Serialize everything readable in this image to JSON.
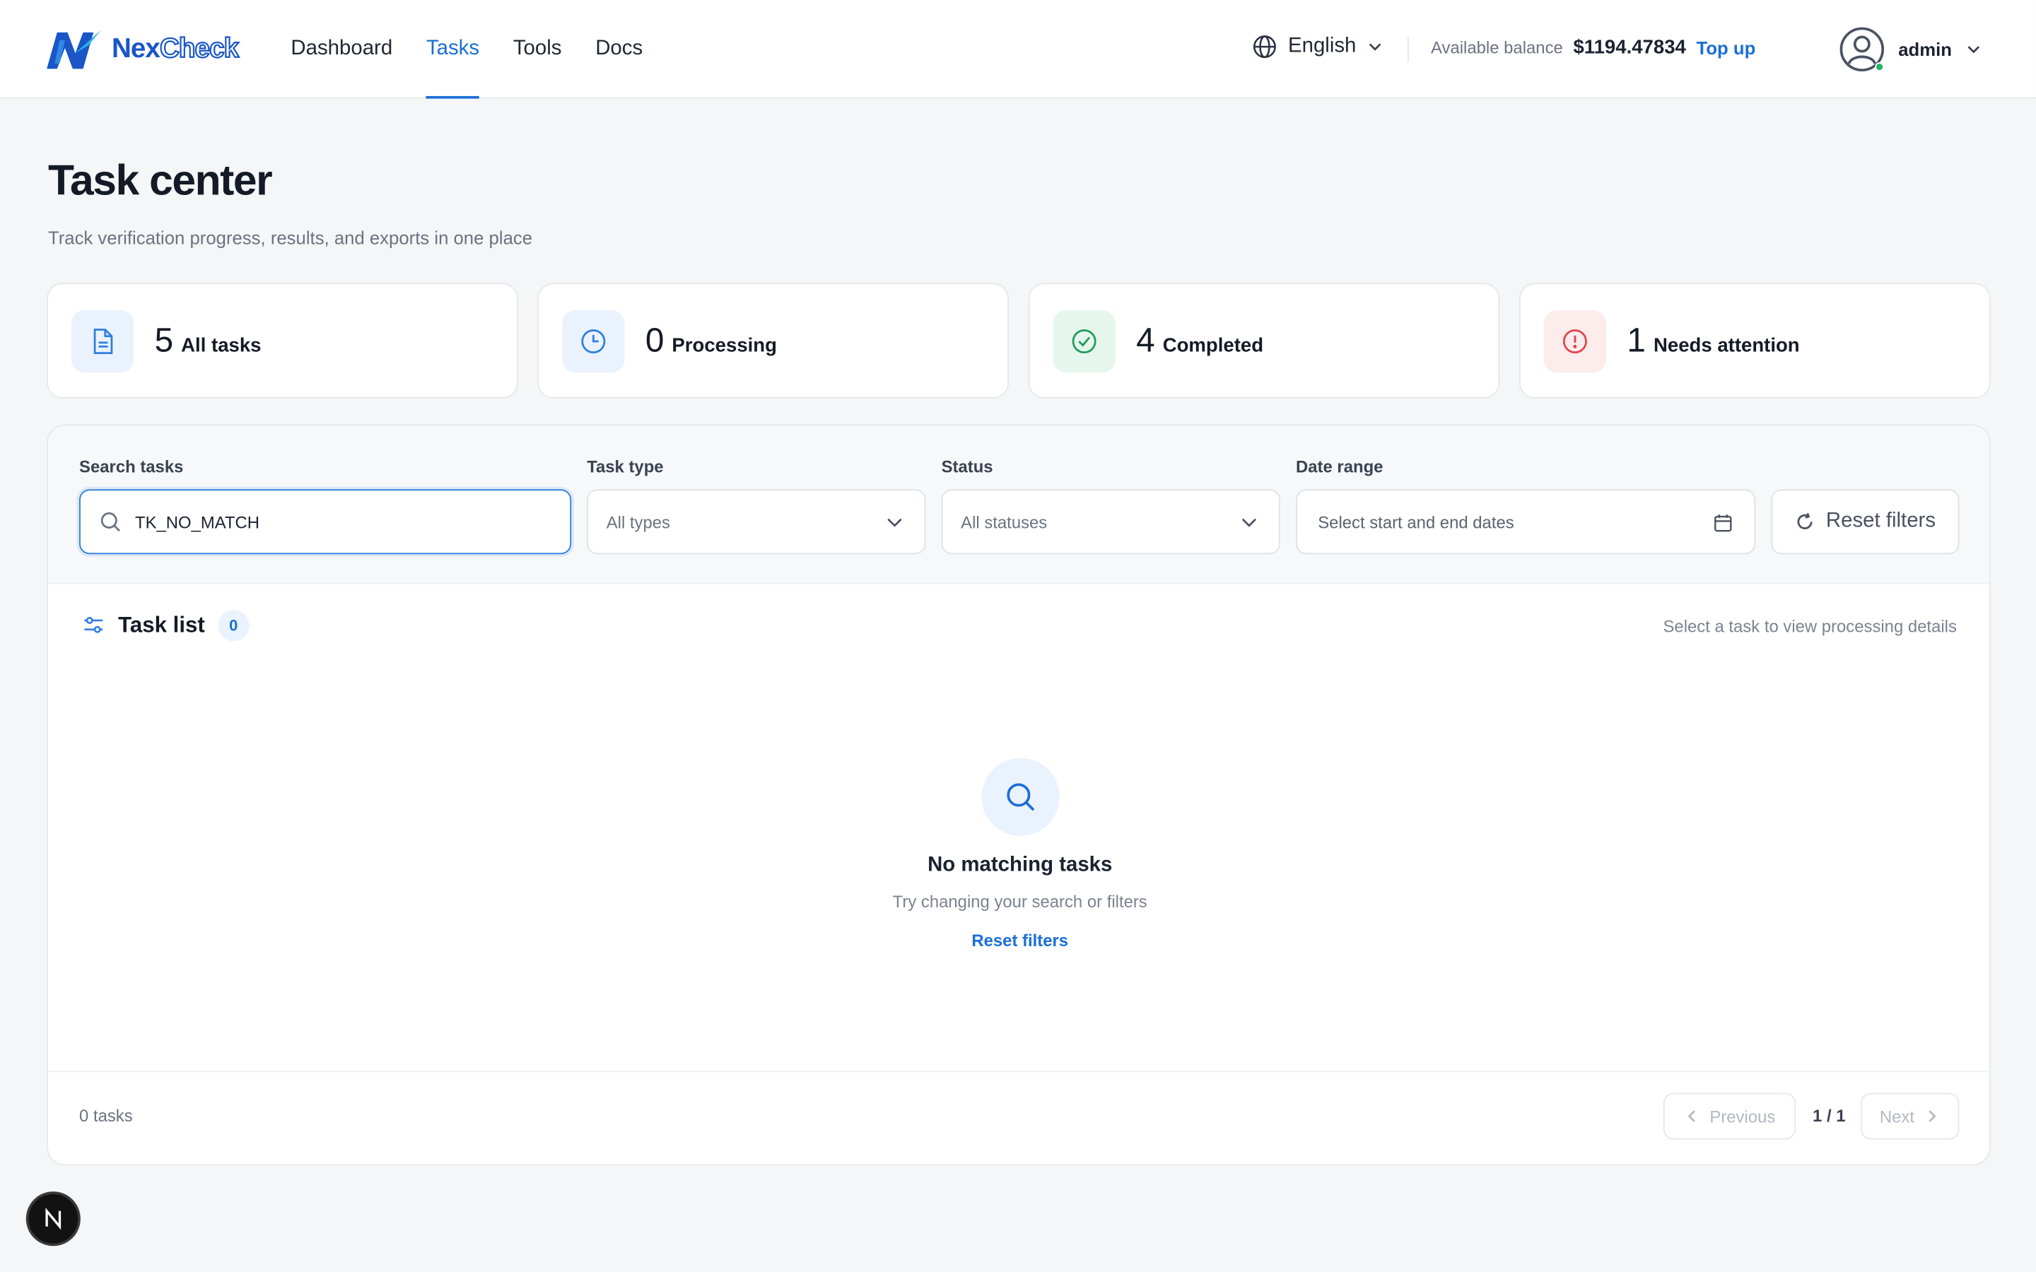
{
  "brand": {
    "name_part1": "Nex",
    "name_part2": "Check",
    "accent": "#1a6fd6"
  },
  "nav": {
    "items": [
      {
        "label": "Dashboard",
        "active": false
      },
      {
        "label": "Tasks",
        "active": true
      },
      {
        "label": "Tools",
        "active": false
      },
      {
        "label": "Docs",
        "active": false
      }
    ]
  },
  "header": {
    "language": "English",
    "balance_label": "Available balance",
    "balance_amount": "$1194.47834",
    "topup_label": "Top up",
    "username": "admin"
  },
  "page": {
    "title": "Task center",
    "subtitle": "Track verification progress, results, and exports in one place"
  },
  "stats": [
    {
      "value": "5",
      "label": "All tasks",
      "icon": "document-icon",
      "color": "#2e7ee0",
      "bg": "#eaf2fd"
    },
    {
      "value": "0",
      "label": "Processing",
      "icon": "clock-icon",
      "color": "#2e7ee0",
      "bg": "#eaf2fd"
    },
    {
      "value": "4",
      "label": "Completed",
      "icon": "check-circle-icon",
      "color": "#1f9d5a",
      "bg": "#e6f6ed"
    },
    {
      "value": "1",
      "label": "Needs attention",
      "icon": "alert-circle-icon",
      "color": "#e0454a",
      "bg": "#fdecec"
    }
  ],
  "filters": {
    "search_label": "Search tasks",
    "search_value": "TK_NO_MATCH",
    "type_label": "Task type",
    "type_value": "All types",
    "status_label": "Status",
    "status_value": "All statuses",
    "date_label": "Date range",
    "date_placeholder": "Select start and end dates",
    "reset_label": "Reset filters"
  },
  "list": {
    "title": "Task list",
    "count": "0",
    "hint": "Select a task to view processing details",
    "empty_title": "No matching tasks",
    "empty_sub": "Try changing your search or filters",
    "empty_action": "Reset filters"
  },
  "pagination": {
    "total": "0 tasks",
    "prev": "Previous",
    "page_info": "1 / 1",
    "next": "Next"
  },
  "fab": {
    "letter": "N"
  }
}
